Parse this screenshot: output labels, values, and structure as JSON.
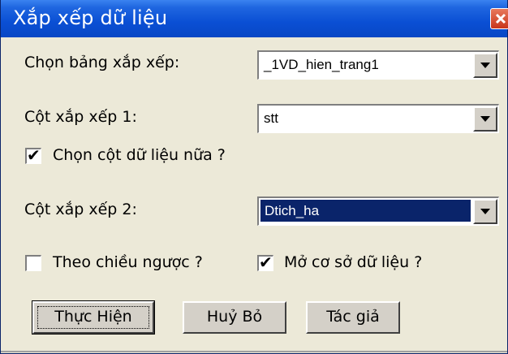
{
  "window": {
    "title": "Xắp xếp dữ liệu",
    "close_icon": "close-icon"
  },
  "form": {
    "table_label": "Chọn bảng xắp xếp:",
    "table_value": "_1VD_hien_trang1",
    "col1_label": "Cột xắp xếp 1:",
    "col1_value": "stt",
    "more_cols_label": "Chọn cột dữ liệu nữa ?",
    "more_cols_checked": true,
    "col2_label": "Cột xắp xếp 2:",
    "col2_value": "Dtich_ha",
    "reverse_label": "Theo chiều ngược ?",
    "reverse_checked": false,
    "open_db_label": "Mở cơ sở dữ liệu ?",
    "open_db_checked": true
  },
  "buttons": {
    "execute": "Thực Hiện",
    "cancel": "Huỷ Bỏ",
    "author": "Tác giả"
  },
  "colors": {
    "titlebar": "#0a4fd4",
    "selection": "#0a246a",
    "face": "#ece9d8"
  }
}
